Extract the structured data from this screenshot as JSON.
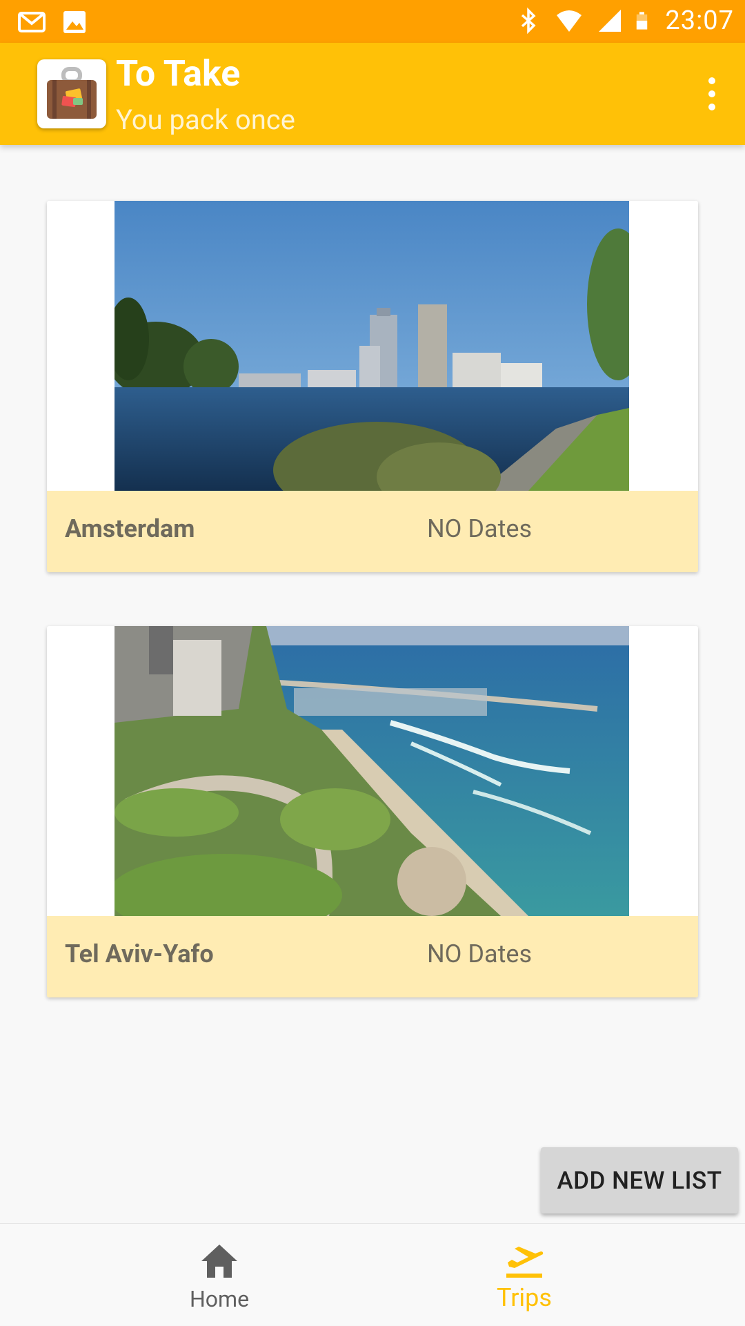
{
  "status_bar": {
    "time": "23:07",
    "left_icons": [
      "gmail-icon",
      "image-icon"
    ],
    "right_icons": [
      "bluetooth-icon",
      "wifi-icon",
      "signal-icon",
      "battery-icon"
    ]
  },
  "app_bar": {
    "title": "To Take",
    "subtitle": "You pack once",
    "logo_icon": "suitcase-icon",
    "menu_icon": "more-vert-icon"
  },
  "trips": [
    {
      "name": "Amsterdam",
      "dates": "NO Dates",
      "image": "amsterdam-photo"
    },
    {
      "name": "Tel Aviv-Yafo",
      "dates": "NO Dates",
      "image": "tel-aviv-photo"
    }
  ],
  "actions": {
    "add_new_list": "ADD NEW LIST"
  },
  "bottom_nav": {
    "items": [
      {
        "label": "Home",
        "icon": "home-icon",
        "active": false
      },
      {
        "label": "Trips",
        "icon": "flight-takeoff-icon",
        "active": true
      }
    ]
  },
  "colors": {
    "status_bar": "#ffa000",
    "app_bar": "#ffc107",
    "card_footer": "#ffecb3",
    "active_nav": "#ffc107"
  }
}
